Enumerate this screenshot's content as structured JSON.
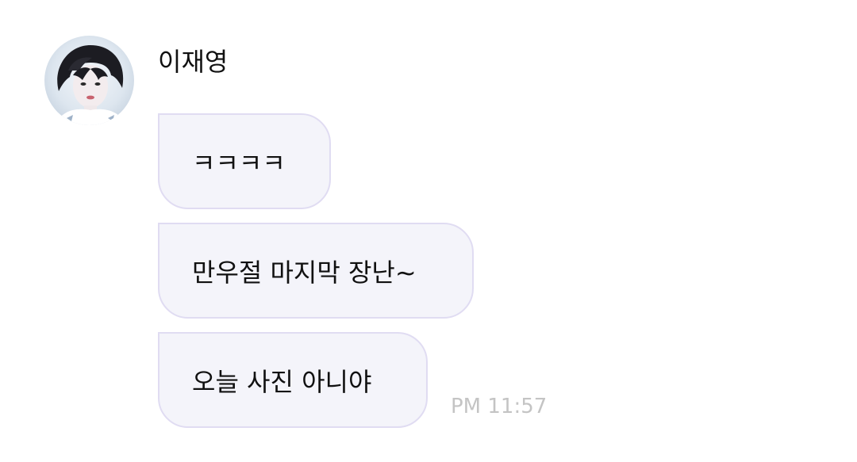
{
  "chat": {
    "sender_name": "이재영",
    "avatar": "profile-photo",
    "messages": [
      {
        "text": "ㅋㅋㅋㅋ"
      },
      {
        "text": "만우절 마지막 장난~"
      },
      {
        "text": "오늘 사진 아니야"
      }
    ],
    "timestamp": "PM 11:57"
  },
  "colors": {
    "bubble_background": "#f4f4fa",
    "bubble_border": "#e0dcf2",
    "text": "#111111",
    "timestamp": "#c4c4c4"
  }
}
